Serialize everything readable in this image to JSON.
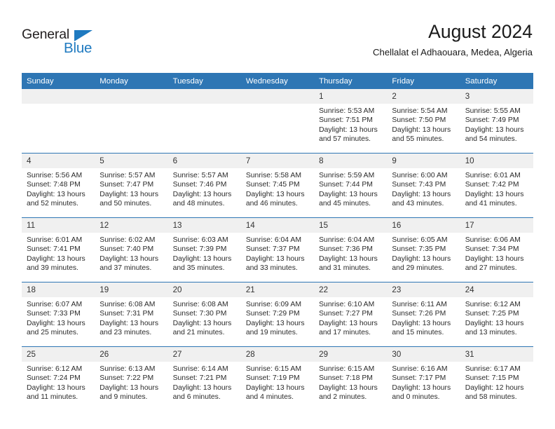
{
  "brand": {
    "name_top": "General",
    "name_bottom": "Blue",
    "triangle_icon": "triangle-icon",
    "color_dark": "#231f20",
    "color_blue": "#1f7ac0"
  },
  "header": {
    "title": "August 2024",
    "subtitle": "Chellalat el Adhaouara, Medea, Algeria"
  },
  "theme": {
    "header_blue": "#2e76b4",
    "daynum_bg": "#f0f0f0",
    "text": "#2b2b2b"
  },
  "weekday_headers": [
    "Sunday",
    "Monday",
    "Tuesday",
    "Wednesday",
    "Thursday",
    "Friday",
    "Saturday"
  ],
  "weeks": [
    [
      {
        "day": "",
        "empty": true,
        "sunrise": "",
        "sunset": "",
        "daylight_1": "",
        "daylight_2": ""
      },
      {
        "day": "",
        "empty": true,
        "sunrise": "",
        "sunset": "",
        "daylight_1": "",
        "daylight_2": ""
      },
      {
        "day": "",
        "empty": true,
        "sunrise": "",
        "sunset": "",
        "daylight_1": "",
        "daylight_2": ""
      },
      {
        "day": "",
        "empty": true,
        "sunrise": "",
        "sunset": "",
        "daylight_1": "",
        "daylight_2": ""
      },
      {
        "day": "1",
        "empty": false,
        "sunrise": "Sunrise: 5:53 AM",
        "sunset": "Sunset: 7:51 PM",
        "daylight_1": "Daylight: 13 hours",
        "daylight_2": "and 57 minutes."
      },
      {
        "day": "2",
        "empty": false,
        "sunrise": "Sunrise: 5:54 AM",
        "sunset": "Sunset: 7:50 PM",
        "daylight_1": "Daylight: 13 hours",
        "daylight_2": "and 55 minutes."
      },
      {
        "day": "3",
        "empty": false,
        "sunrise": "Sunrise: 5:55 AM",
        "sunset": "Sunset: 7:49 PM",
        "daylight_1": "Daylight: 13 hours",
        "daylight_2": "and 54 minutes."
      }
    ],
    [
      {
        "day": "4",
        "empty": false,
        "sunrise": "Sunrise: 5:56 AM",
        "sunset": "Sunset: 7:48 PM",
        "daylight_1": "Daylight: 13 hours",
        "daylight_2": "and 52 minutes."
      },
      {
        "day": "5",
        "empty": false,
        "sunrise": "Sunrise: 5:57 AM",
        "sunset": "Sunset: 7:47 PM",
        "daylight_1": "Daylight: 13 hours",
        "daylight_2": "and 50 minutes."
      },
      {
        "day": "6",
        "empty": false,
        "sunrise": "Sunrise: 5:57 AM",
        "sunset": "Sunset: 7:46 PM",
        "daylight_1": "Daylight: 13 hours",
        "daylight_2": "and 48 minutes."
      },
      {
        "day": "7",
        "empty": false,
        "sunrise": "Sunrise: 5:58 AM",
        "sunset": "Sunset: 7:45 PM",
        "daylight_1": "Daylight: 13 hours",
        "daylight_2": "and 46 minutes."
      },
      {
        "day": "8",
        "empty": false,
        "sunrise": "Sunrise: 5:59 AM",
        "sunset": "Sunset: 7:44 PM",
        "daylight_1": "Daylight: 13 hours",
        "daylight_2": "and 45 minutes."
      },
      {
        "day": "9",
        "empty": false,
        "sunrise": "Sunrise: 6:00 AM",
        "sunset": "Sunset: 7:43 PM",
        "daylight_1": "Daylight: 13 hours",
        "daylight_2": "and 43 minutes."
      },
      {
        "day": "10",
        "empty": false,
        "sunrise": "Sunrise: 6:01 AM",
        "sunset": "Sunset: 7:42 PM",
        "daylight_1": "Daylight: 13 hours",
        "daylight_2": "and 41 minutes."
      }
    ],
    [
      {
        "day": "11",
        "empty": false,
        "sunrise": "Sunrise: 6:01 AM",
        "sunset": "Sunset: 7:41 PM",
        "daylight_1": "Daylight: 13 hours",
        "daylight_2": "and 39 minutes."
      },
      {
        "day": "12",
        "empty": false,
        "sunrise": "Sunrise: 6:02 AM",
        "sunset": "Sunset: 7:40 PM",
        "daylight_1": "Daylight: 13 hours",
        "daylight_2": "and 37 minutes."
      },
      {
        "day": "13",
        "empty": false,
        "sunrise": "Sunrise: 6:03 AM",
        "sunset": "Sunset: 7:39 PM",
        "daylight_1": "Daylight: 13 hours",
        "daylight_2": "and 35 minutes."
      },
      {
        "day": "14",
        "empty": false,
        "sunrise": "Sunrise: 6:04 AM",
        "sunset": "Sunset: 7:37 PM",
        "daylight_1": "Daylight: 13 hours",
        "daylight_2": "and 33 minutes."
      },
      {
        "day": "15",
        "empty": false,
        "sunrise": "Sunrise: 6:04 AM",
        "sunset": "Sunset: 7:36 PM",
        "daylight_1": "Daylight: 13 hours",
        "daylight_2": "and 31 minutes."
      },
      {
        "day": "16",
        "empty": false,
        "sunrise": "Sunrise: 6:05 AM",
        "sunset": "Sunset: 7:35 PM",
        "daylight_1": "Daylight: 13 hours",
        "daylight_2": "and 29 minutes."
      },
      {
        "day": "17",
        "empty": false,
        "sunrise": "Sunrise: 6:06 AM",
        "sunset": "Sunset: 7:34 PM",
        "daylight_1": "Daylight: 13 hours",
        "daylight_2": "and 27 minutes."
      }
    ],
    [
      {
        "day": "18",
        "empty": false,
        "sunrise": "Sunrise: 6:07 AM",
        "sunset": "Sunset: 7:33 PM",
        "daylight_1": "Daylight: 13 hours",
        "daylight_2": "and 25 minutes."
      },
      {
        "day": "19",
        "empty": false,
        "sunrise": "Sunrise: 6:08 AM",
        "sunset": "Sunset: 7:31 PM",
        "daylight_1": "Daylight: 13 hours",
        "daylight_2": "and 23 minutes."
      },
      {
        "day": "20",
        "empty": false,
        "sunrise": "Sunrise: 6:08 AM",
        "sunset": "Sunset: 7:30 PM",
        "daylight_1": "Daylight: 13 hours",
        "daylight_2": "and 21 minutes."
      },
      {
        "day": "21",
        "empty": false,
        "sunrise": "Sunrise: 6:09 AM",
        "sunset": "Sunset: 7:29 PM",
        "daylight_1": "Daylight: 13 hours",
        "daylight_2": "and 19 minutes."
      },
      {
        "day": "22",
        "empty": false,
        "sunrise": "Sunrise: 6:10 AM",
        "sunset": "Sunset: 7:27 PM",
        "daylight_1": "Daylight: 13 hours",
        "daylight_2": "and 17 minutes."
      },
      {
        "day": "23",
        "empty": false,
        "sunrise": "Sunrise: 6:11 AM",
        "sunset": "Sunset: 7:26 PM",
        "daylight_1": "Daylight: 13 hours",
        "daylight_2": "and 15 minutes."
      },
      {
        "day": "24",
        "empty": false,
        "sunrise": "Sunrise: 6:12 AM",
        "sunset": "Sunset: 7:25 PM",
        "daylight_1": "Daylight: 13 hours",
        "daylight_2": "and 13 minutes."
      }
    ],
    [
      {
        "day": "25",
        "empty": false,
        "sunrise": "Sunrise: 6:12 AM",
        "sunset": "Sunset: 7:24 PM",
        "daylight_1": "Daylight: 13 hours",
        "daylight_2": "and 11 minutes."
      },
      {
        "day": "26",
        "empty": false,
        "sunrise": "Sunrise: 6:13 AM",
        "sunset": "Sunset: 7:22 PM",
        "daylight_1": "Daylight: 13 hours",
        "daylight_2": "and 9 minutes."
      },
      {
        "day": "27",
        "empty": false,
        "sunrise": "Sunrise: 6:14 AM",
        "sunset": "Sunset: 7:21 PM",
        "daylight_1": "Daylight: 13 hours",
        "daylight_2": "and 6 minutes."
      },
      {
        "day": "28",
        "empty": false,
        "sunrise": "Sunrise: 6:15 AM",
        "sunset": "Sunset: 7:19 PM",
        "daylight_1": "Daylight: 13 hours",
        "daylight_2": "and 4 minutes."
      },
      {
        "day": "29",
        "empty": false,
        "sunrise": "Sunrise: 6:15 AM",
        "sunset": "Sunset: 7:18 PM",
        "daylight_1": "Daylight: 13 hours",
        "daylight_2": "and 2 minutes."
      },
      {
        "day": "30",
        "empty": false,
        "sunrise": "Sunrise: 6:16 AM",
        "sunset": "Sunset: 7:17 PM",
        "daylight_1": "Daylight: 13 hours",
        "daylight_2": "and 0 minutes."
      },
      {
        "day": "31",
        "empty": false,
        "sunrise": "Sunrise: 6:17 AM",
        "sunset": "Sunset: 7:15 PM",
        "daylight_1": "Daylight: 12 hours",
        "daylight_2": "and 58 minutes."
      }
    ]
  ]
}
